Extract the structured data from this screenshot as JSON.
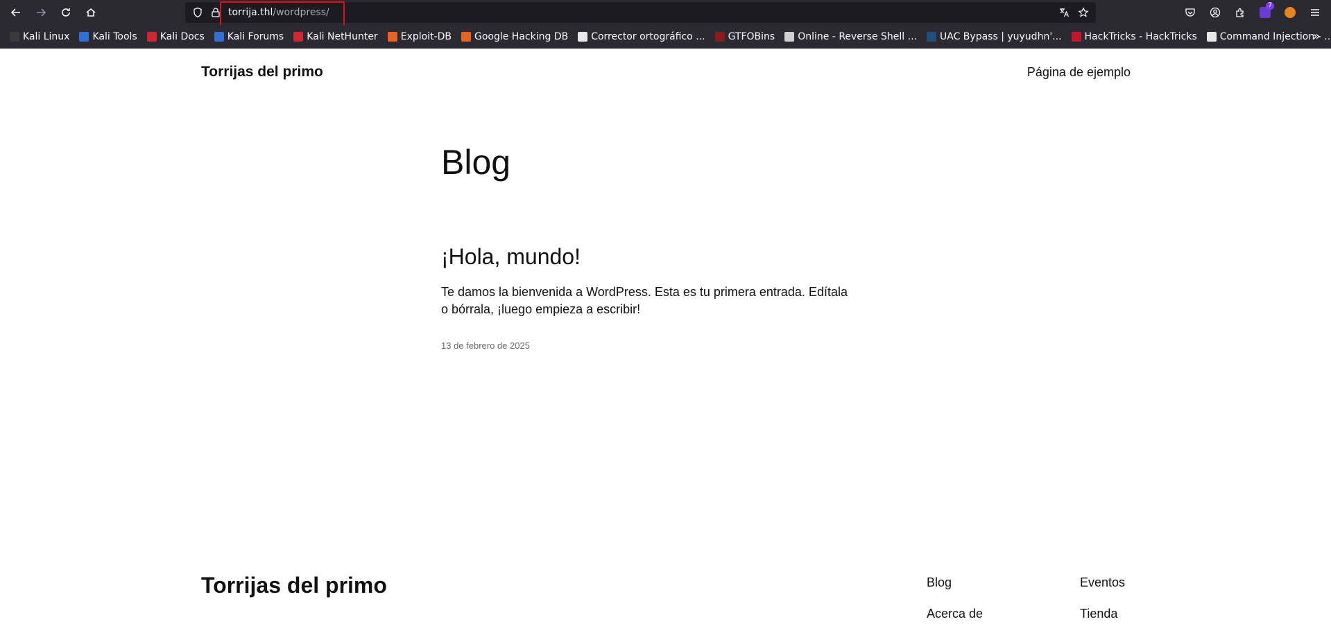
{
  "browser": {
    "url_host": "torrija.thl",
    "url_path": "/wordpress/",
    "extension_badge": "7"
  },
  "bookmarks": [
    {
      "label": "Kali Linux",
      "color": "#3a3a3a"
    },
    {
      "label": "Kali Tools",
      "color": "#2f6fd6"
    },
    {
      "label": "Kali Docs",
      "color": "#d0262d"
    },
    {
      "label": "Kali Forums",
      "color": "#2f6fd6"
    },
    {
      "label": "Kali NetHunter",
      "color": "#d0262d"
    },
    {
      "label": "Exploit-DB",
      "color": "#e8641e"
    },
    {
      "label": "Google Hacking DB",
      "color": "#e8641e"
    },
    {
      "label": "Corrector ortográfico ...",
      "color": "#e8e8e8"
    },
    {
      "label": "GTFOBins",
      "color": "#8a1b1b"
    },
    {
      "label": "Online - Reverse Shell ...",
      "color": "#cfcfcf"
    },
    {
      "label": "UAC Bypass | yuyudhn'...",
      "color": "#1f4f7a"
    },
    {
      "label": "HackTricks - HackTricks",
      "color": "#c7152a"
    },
    {
      "label": "Command Injection - ...",
      "color": "#e8e8e8"
    }
  ],
  "site": {
    "title": "Torrijas del primo",
    "nav_item": "Página de ejemplo"
  },
  "main": {
    "heading": "Blog",
    "post": {
      "title": "¡Hola, mundo!",
      "excerpt": "Te damos la bienvenida a WordPress. Esta es tu primera entrada. Edítala o bórrala, ¡luego empieza a escribir!",
      "date": "13 de febrero de 2025"
    }
  },
  "footer": {
    "title": "Torrijas del primo",
    "links": [
      "Blog",
      "Eventos",
      "Acerca de",
      "Tienda"
    ]
  },
  "colors": {
    "chrome_bg": "#2b2a33",
    "urlbar_bg": "#1c1b22",
    "highlight": "#e0101a"
  }
}
